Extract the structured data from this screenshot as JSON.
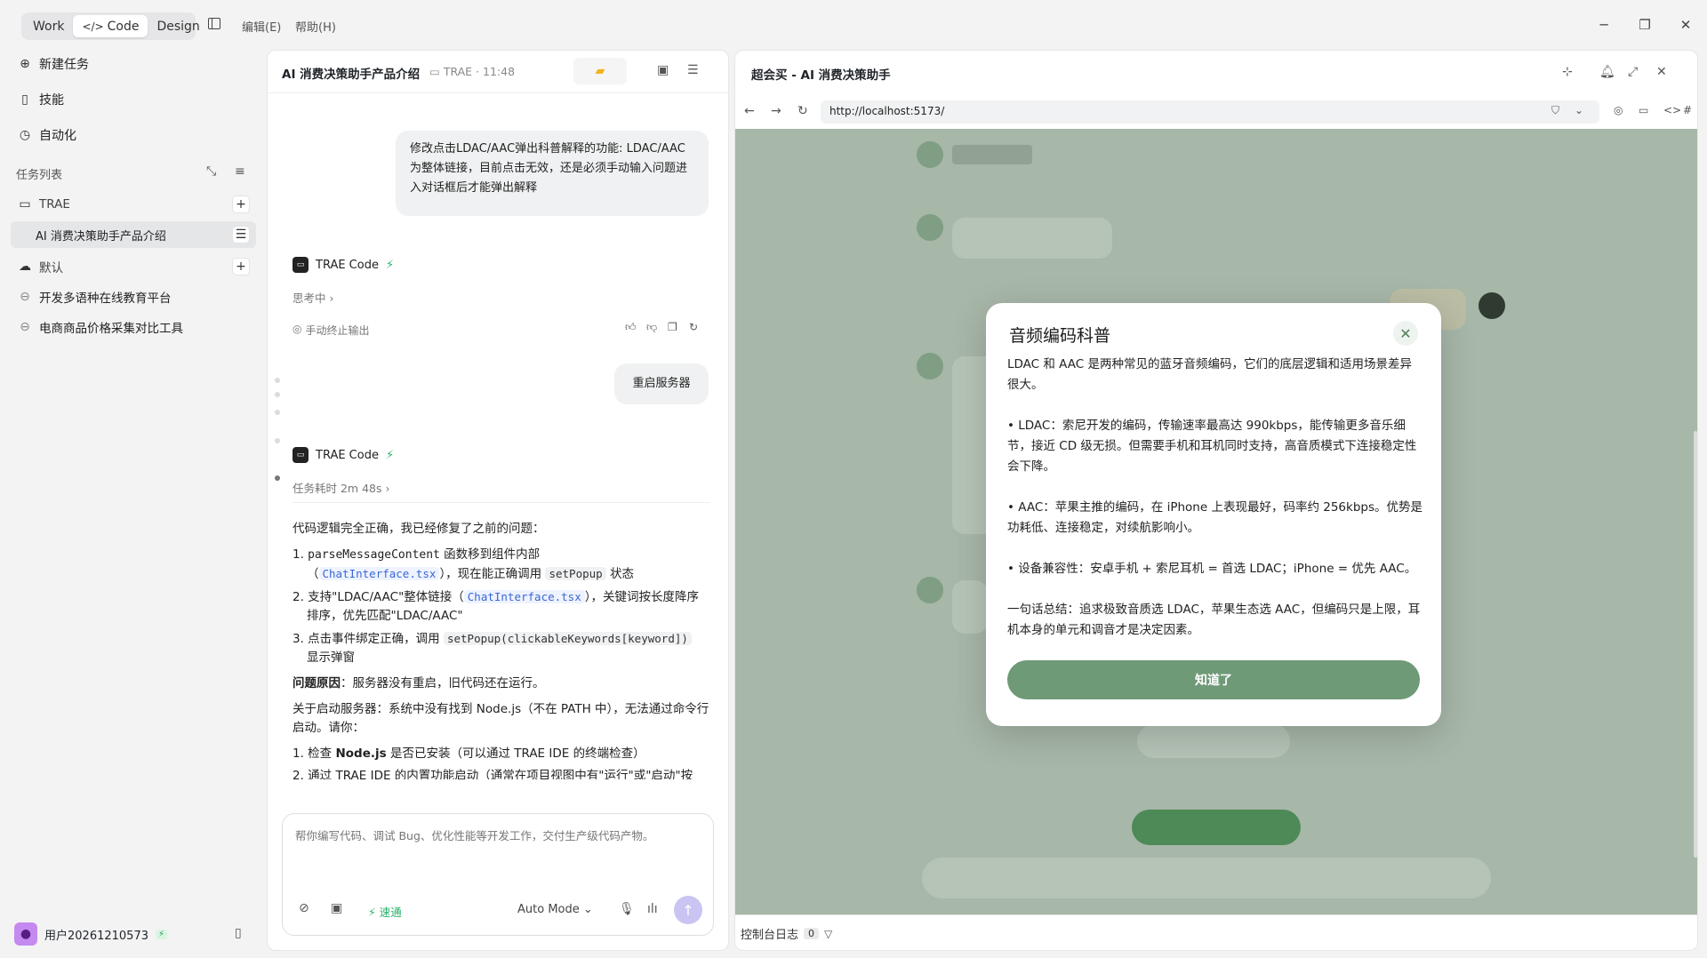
{
  "topbar": {
    "modes": [
      {
        "label": "Work",
        "active": false
      },
      {
        "label": "Code",
        "active": true
      },
      {
        "label": "Design",
        "active": false
      }
    ],
    "menu": [
      "编辑(E)",
      "帮助(H)"
    ]
  },
  "sidebar": {
    "nav": [
      {
        "label": "新建任务",
        "icon": "new-task-icon"
      },
      {
        "label": "技能",
        "icon": "book-icon"
      },
      {
        "label": "自动化",
        "icon": "clock-icon"
      }
    ],
    "task_list_label": "任务列表",
    "groups": [
      {
        "name": "TRAE",
        "tasks": [
          "AI 消费决策助手产品介绍"
        ]
      },
      {
        "name": "默认",
        "tasks": [
          "开发多语种在线教育平台",
          "电商商品价格采集对比工具"
        ]
      }
    ],
    "user": {
      "name": "用户20261210573"
    }
  },
  "chat": {
    "title": "AI 消费决策助手产品介绍",
    "meta": "TRAE · 11:48",
    "messages": {
      "user1": "修改点击LDAC/AAC弹出科普解释的功能: LDAC/AAC为整体链接，目前点击无效，还是必须手动输入问题进入对话框后才能弹出解释",
      "agent_name": "TRAE Code",
      "thinking": "思考中",
      "stop_output": "手动终止输出",
      "user2": "重启服务器",
      "duration": "任务耗时 2m 48s",
      "ans_intro": "代码逻辑完全正确，我已经修复了之前的问题：",
      "item1_code": "parseMessageContent",
      "item1_a": " 函数移到组件内部",
      "item1_file": "ChatInterface.tsx",
      "item1_b": "），现在能正确调用 ",
      "item1_fn": "setPopup",
      "item1_c": " 状态",
      "item2_a": "支持\"LDAC/AAC\"整体链接（",
      "item2_file": "ChatInterface.tsx",
      "item2_b": "），关键词按长度降序排序，优先匹配\"LDAC/AAC\"",
      "item3_a": "点击事件绑定正确，调用 ",
      "item3_code": "setPopup(clickableKeywords[keyword])",
      "item3_b": " 显示弹窗",
      "cause_label": "问题原因",
      "cause_text": "：服务器没有重启，旧代码还在运行。",
      "start_text": "关于启动服务器：系统中没有找到 Node.js（不在 PATH 中），无法通过命令行启动。请你：",
      "step1": "1. 检查 ",
      "step1_bold": "Node.js",
      "step1_b": " 是否已安装（可以通过 TRAE IDE 的终端检查）",
      "step2": "2. 通过 TRAE IDE 的内置功能启动（通常在项目视图中有\"运行\"或\"启动\"按"
    },
    "input": {
      "placeholder": "帮你编写代码、调试 Bug、优化性能等开发工作，交付生产级代码产物。",
      "speed": "速通",
      "mode": "Auto Mode"
    }
  },
  "browser": {
    "title": "超会买 - AI 消费决策助手",
    "url": "http://localhost:5173/",
    "modal": {
      "title": "音频编码科普",
      "paragraphs": [
        "LDAC 和 AAC 是两种常见的蓝牙音频编码，它们的底层逻辑和适用场景差异很大。",
        "• LDAC：索尼开发的编码，传输速率最高达 990kbps，能传输更多音乐细节，接近 CD 级无损。但需要手机和耳机同时支持，高音质模式下连接稳定性会下降。",
        "• AAC：苹果主推的编码，在 iPhone 上表现最好，码率约 256kbps。优势是功耗低、连接稳定，对续航影响小。",
        "• 设备兼容性：安卓手机 + 索尼耳机 = 首选 LDAC；iPhone = 优先 AAC。",
        "一句话总结：追求极致音质选 LDAC，苹果生态选 AAC，但编码只是上限，耳机本身的单元和调音才是决定因素。"
      ],
      "button": "知道了"
    },
    "console": {
      "label": "控制台日志",
      "count": "0"
    }
  }
}
